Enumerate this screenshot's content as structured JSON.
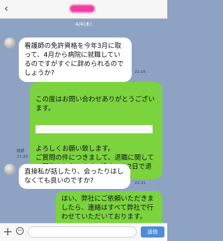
{
  "header": {
    "back_glyph": "‹"
  },
  "date_label": "4/4(木)",
  "messages": [
    {
      "text": "看護師の免許資格を今年3月に取って、4月から病院に就職しているのですがすぐに辞められるのでしょうか?",
      "time": "21:16"
    },
    {
      "text_a": "この度はお問い合わせありがとうございます。",
      "text_b": "よろしくお願い致します。\nご質問の件につきまして、退職に関しては可能かと存じます。過去にも2日で退職した看護師の方がおりました。",
      "read": "既読",
      "time": "21:20"
    },
    {
      "text": "直接私が話したり、会ったりはしなくても良いのですか?",
      "time": "21:21"
    },
    {
      "text": "はい、弊社にご依頼いただきましたら、連絡はすべて弊社で行わせていただいております。"
    }
  ],
  "composer": {
    "plus_glyph": "+",
    "send_label": "送信"
  }
}
